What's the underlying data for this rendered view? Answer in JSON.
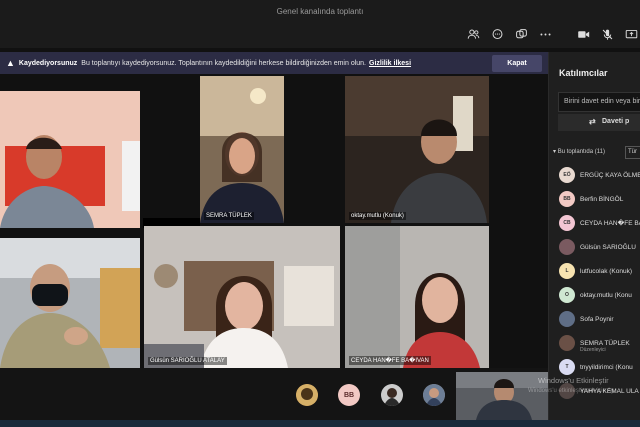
{
  "window": {
    "title": "Genel kanalında toplantı"
  },
  "banner": {
    "title": "Kaydediyorsunuz",
    "message": "Bu toplantıyı kaydediyorsunuz. Toplantının kaydedildiğini herkese bildirdiğinizden emin olun.",
    "link": "Gizlilik ilkesi",
    "close_button": "Kapat"
  },
  "tiles": [
    {
      "name": ""
    },
    {
      "name": "SEMRA TÜPLEK"
    },
    {
      "name": "oktay.mutlu (Konuk)"
    },
    {
      "name": ""
    },
    {
      "name": "Gülsün SARIOĞLU ATALAY"
    },
    {
      "name": "CEYDA HAN�FE BA�IVAN"
    }
  ],
  "bottom_avatars": [
    {
      "initials": ""
    },
    {
      "initials": "BB"
    },
    {
      "initials": ""
    },
    {
      "initials": ""
    }
  ],
  "panel": {
    "title": "Katılımcılar",
    "invite_placeholder": "Birini davet edin veya bir",
    "share_label": "Daveti p",
    "section_label": "Bu toplantıda (11)",
    "section_button": "Tür",
    "participants": [
      {
        "initials": "EÖ",
        "name": "ERGÜÇ KAYA ÖLME",
        "color": "#e8d9d0",
        "sub": ""
      },
      {
        "initials": "BB",
        "name": "Berfin BİNGÖL",
        "color": "#f2c9c4",
        "sub": ""
      },
      {
        "initials": "CB",
        "name": "CEYDA HAN�FE BA",
        "color": "#f3c6d3",
        "sub": ""
      },
      {
        "initials": "",
        "name": "Gülsün SARIOĞLU",
        "color": "#7a5a60",
        "sub": ""
      },
      {
        "initials": "L",
        "name": "lutfucolak (Konuk)",
        "color": "#f7e3b0",
        "sub": ""
      },
      {
        "initials": "O",
        "name": "oktay.mutlu (Konu",
        "color": "#cfe8d2",
        "sub": ""
      },
      {
        "initials": "",
        "name": "Sofa Poynir",
        "color": "#5f6e86",
        "sub": ""
      },
      {
        "initials": "",
        "name": "SEMRA TÜPLEK",
        "color": "#6a5046",
        "sub": "Düzenleyici"
      },
      {
        "initials": "T",
        "name": "tnyyildirimci (Konu",
        "color": "#d9dbf2",
        "sub": ""
      },
      {
        "initials": "",
        "name": "YAHYA KEMAL ULA",
        "color": "#524644",
        "sub": ""
      }
    ]
  },
  "watermark": {
    "line1": "Windows'u Etkinleştir",
    "line2": "Windows'u etkinleştirmek için Ay"
  }
}
